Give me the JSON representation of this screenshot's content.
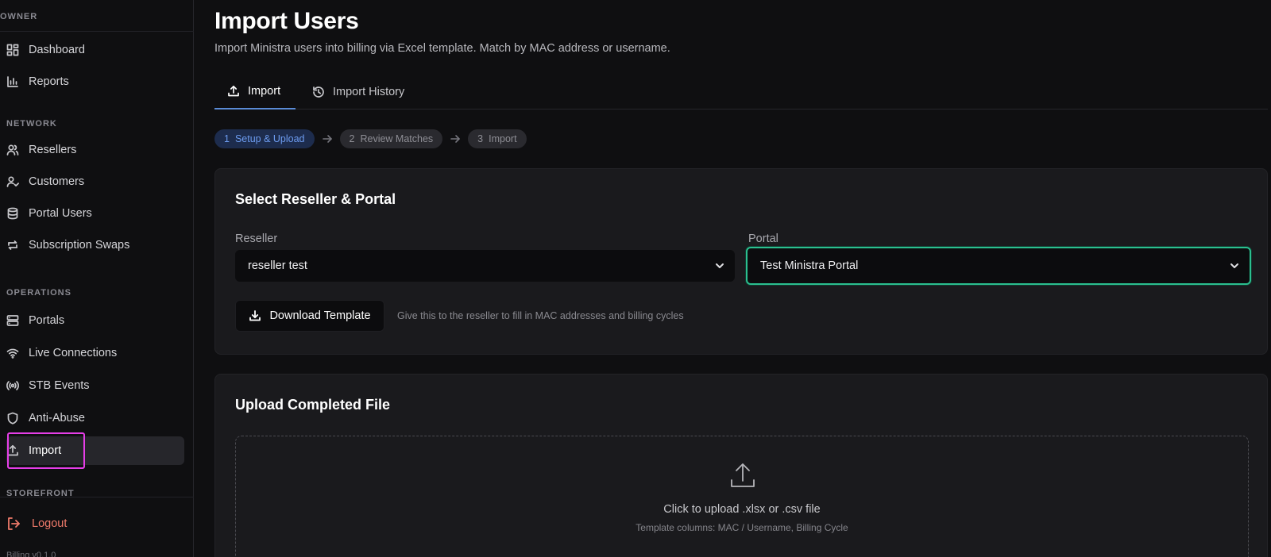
{
  "sidebar": {
    "sections": {
      "owner": "OWNER",
      "network": "NETWORK",
      "operations": "OPERATIONS",
      "storefront": "STOREFRONT"
    },
    "items": {
      "dashboard": "Dashboard",
      "reports": "Reports",
      "resellers": "Resellers",
      "customers": "Customers",
      "portal_users": "Portal Users",
      "subscription_swaps": "Subscription Swaps",
      "portals": "Portals",
      "live_connections": "Live Connections",
      "stb_events": "STB Events",
      "anti_abuse": "Anti-Abuse",
      "import": "Import"
    },
    "logout": "Logout",
    "version": "Billing v0.1.0"
  },
  "header": {
    "title": "Import Users",
    "subtitle": "Import Ministra users into billing via Excel template. Match by MAC address or username."
  },
  "tabs": {
    "import": "Import",
    "history": "Import History"
  },
  "steps": [
    {
      "num": "1",
      "label": "Setup & Upload"
    },
    {
      "num": "2",
      "label": "Review Matches"
    },
    {
      "num": "3",
      "label": "Import"
    }
  ],
  "select_card": {
    "title": "Select Reseller & Portal",
    "reseller_label": "Reseller",
    "reseller_value": "reseller test",
    "portal_label": "Portal",
    "portal_value": "Test Ministra Portal",
    "download_label": "Download Template",
    "download_hint": "Give this to the reseller to fill in MAC addresses and billing cycles"
  },
  "upload_card": {
    "title": "Upload Completed File",
    "dropzone_text": "Click to upload .xlsx or .csv file",
    "dropzone_sub": "Template columns: MAC / Username, Billing Cycle"
  },
  "colors": {
    "accent": "#5a8bd6",
    "focus_ring": "#2bbf8f",
    "logout": "#ef7a6a",
    "highlight": "#e63ee8"
  }
}
